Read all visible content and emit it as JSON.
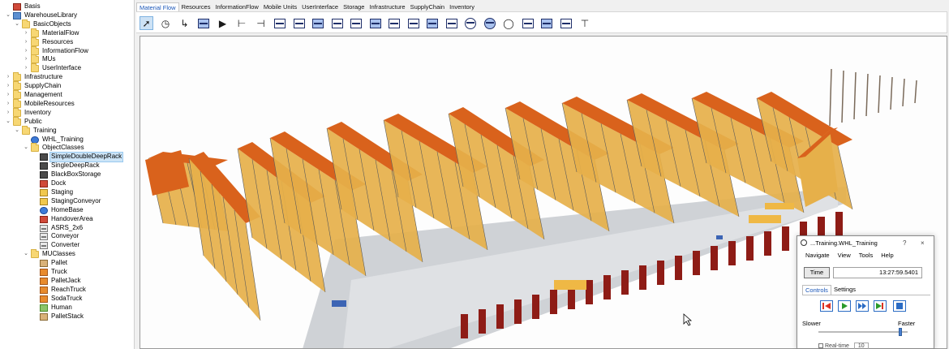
{
  "tree": {
    "items": [
      {
        "label": "Basis",
        "depth": 0,
        "chev": "",
        "icon": "network-icon",
        "style": "red"
      },
      {
        "label": "WarehouseLibrary",
        "depth": 0,
        "chev": "v",
        "icon": "library-icon",
        "style": "box"
      },
      {
        "label": "BasicObjects",
        "depth": 1,
        "chev": "v",
        "icon": "folder-icon",
        "style": "folder"
      },
      {
        "label": "MaterialFlow",
        "depth": 2,
        "chev": ">",
        "icon": "folder-icon",
        "style": "folder"
      },
      {
        "label": "Resources",
        "depth": 2,
        "chev": ">",
        "icon": "folder-icon",
        "style": "folder"
      },
      {
        "label": "InformationFlow",
        "depth": 2,
        "chev": ">",
        "icon": "folder-icon",
        "style": "folder"
      },
      {
        "label": "MUs",
        "depth": 2,
        "chev": ">",
        "icon": "folder-icon",
        "style": "folder"
      },
      {
        "label": "UserInterface",
        "depth": 2,
        "chev": ">",
        "icon": "folder-icon",
        "style": "folder"
      },
      {
        "label": "Infrastructure",
        "depth": 0,
        "chev": ">",
        "icon": "folder-icon",
        "style": "folder"
      },
      {
        "label": "SupplyChain",
        "depth": 0,
        "chev": ">",
        "icon": "folder-icon",
        "style": "folder"
      },
      {
        "label": "Management",
        "depth": 0,
        "chev": ">",
        "icon": "folder-icon",
        "style": "folder"
      },
      {
        "label": "MobileResources",
        "depth": 0,
        "chev": ">",
        "icon": "folder-icon",
        "style": "folder"
      },
      {
        "label": "Inventory",
        "depth": 0,
        "chev": ">",
        "icon": "folder-icon",
        "style": "folder"
      },
      {
        "label": "Public",
        "depth": 0,
        "chev": "v",
        "icon": "folder-icon",
        "style": "folder"
      },
      {
        "label": "Training",
        "depth": 1,
        "chev": "v",
        "icon": "folder-icon",
        "style": "folder"
      },
      {
        "label": "WHL_Training",
        "depth": 2,
        "chev": "",
        "icon": "frame-icon",
        "style": "blue"
      },
      {
        "label": "ObjectClasses",
        "depth": 2,
        "chev": "v",
        "icon": "folder-icon",
        "style": "folder"
      },
      {
        "label": "SimpleDoubleDeepRack",
        "depth": 3,
        "chev": "",
        "icon": "rack-icon",
        "style": "dark",
        "selected": true
      },
      {
        "label": "SingleDeepRack",
        "depth": 3,
        "chev": "",
        "icon": "rack-icon",
        "style": "dark"
      },
      {
        "label": "BlackBoxStorage",
        "depth": 3,
        "chev": "",
        "icon": "storage-icon",
        "style": "dark"
      },
      {
        "label": "Dock",
        "depth": 3,
        "chev": "",
        "icon": "dock-icon",
        "style": "red"
      },
      {
        "label": "Staging",
        "depth": 3,
        "chev": "",
        "icon": "staging-icon",
        "style": "yellowbox"
      },
      {
        "label": "StagingConveyor",
        "depth": 3,
        "chev": "",
        "icon": "conveyor-icon",
        "style": "yellowbox"
      },
      {
        "label": "HomeBase",
        "depth": 3,
        "chev": "",
        "icon": "homebase-icon",
        "style": "blue"
      },
      {
        "label": "HandoverArea",
        "depth": 3,
        "chev": "",
        "icon": "handover-icon",
        "style": "red"
      },
      {
        "label": "ASRS_2x6",
        "depth": 3,
        "chev": "",
        "icon": "asrs-icon",
        "style": "cls"
      },
      {
        "label": "Conveyor",
        "depth": 3,
        "chev": "",
        "icon": "conveyor-icon",
        "style": "cls"
      },
      {
        "label": "Converter",
        "depth": 3,
        "chev": "",
        "icon": "converter-icon",
        "style": "cls"
      },
      {
        "label": "MUClasses",
        "depth": 2,
        "chev": "v",
        "icon": "folder-icon",
        "style": "folder"
      },
      {
        "label": "Pallet",
        "depth": 3,
        "chev": "",
        "icon": "pallet-icon",
        "style": "tan"
      },
      {
        "label": "Truck",
        "depth": 3,
        "chev": "",
        "icon": "truck-icon",
        "style": "orange"
      },
      {
        "label": "PalletJack",
        "depth": 3,
        "chev": "",
        "icon": "palletjack-icon",
        "style": "orange"
      },
      {
        "label": "ReachTruck",
        "depth": 3,
        "chev": "",
        "icon": "reachtruck-icon",
        "style": "orange"
      },
      {
        "label": "SodaTruck",
        "depth": 3,
        "chev": "",
        "icon": "sodatruck-icon",
        "style": "orange"
      },
      {
        "label": "Human",
        "depth": 3,
        "chev": "",
        "icon": "human-icon",
        "style": "green"
      },
      {
        "label": "PalletStack",
        "depth": 3,
        "chev": "",
        "icon": "palletstack-icon",
        "style": "tan"
      }
    ]
  },
  "tabs": [
    "Material Flow",
    "Resources",
    "InformationFlow",
    "Mobile Units",
    "UserInterface",
    "Storage",
    "Infrastructure",
    "SupplyChain",
    "Inventory"
  ],
  "active_tab": "Material Flow",
  "toolbar": {
    "icons": [
      "pointer-icon",
      "eventcontroller-icon",
      "connector-icon",
      "flow-icon",
      "play-icon",
      "source-icon",
      "drain-icon",
      "singleproc-icon",
      "parallelproc-icon",
      "assembly-icon",
      "dismantle-icon",
      "cycle-icon",
      "buffer-icon",
      "placebuffer-icon",
      "sorter-icon",
      "line-icon",
      "angular-converter-icon",
      "turntable-icon",
      "turnplate-icon",
      "circle-icon",
      "store-icon",
      "storage-icon",
      "track-icon",
      "hierarchy-icon"
    ]
  },
  "panel": {
    "title": "...Training.WHL_Training",
    "help": "?",
    "close": "×",
    "menu": [
      "Navigate",
      "View",
      "Tools",
      "Help"
    ],
    "time_label": "Time",
    "time_value": "13:27:59.5401",
    "subtabs": [
      "Controls",
      "Settings"
    ],
    "active_subtab": "Controls",
    "slower": "Slower",
    "faster": "Faster",
    "speed_fraction": 0.9,
    "realtime": "Real-time",
    "realtime_factor": "10"
  },
  "colors": {
    "rack_top": "#d9621c",
    "rack_front": "#e6b04a",
    "rack_frame": "#5a5a5a",
    "floor": "#cfd2d6",
    "dock": "#8e1c16",
    "selection": "#cce4f7",
    "accent": "#1a56b8"
  }
}
